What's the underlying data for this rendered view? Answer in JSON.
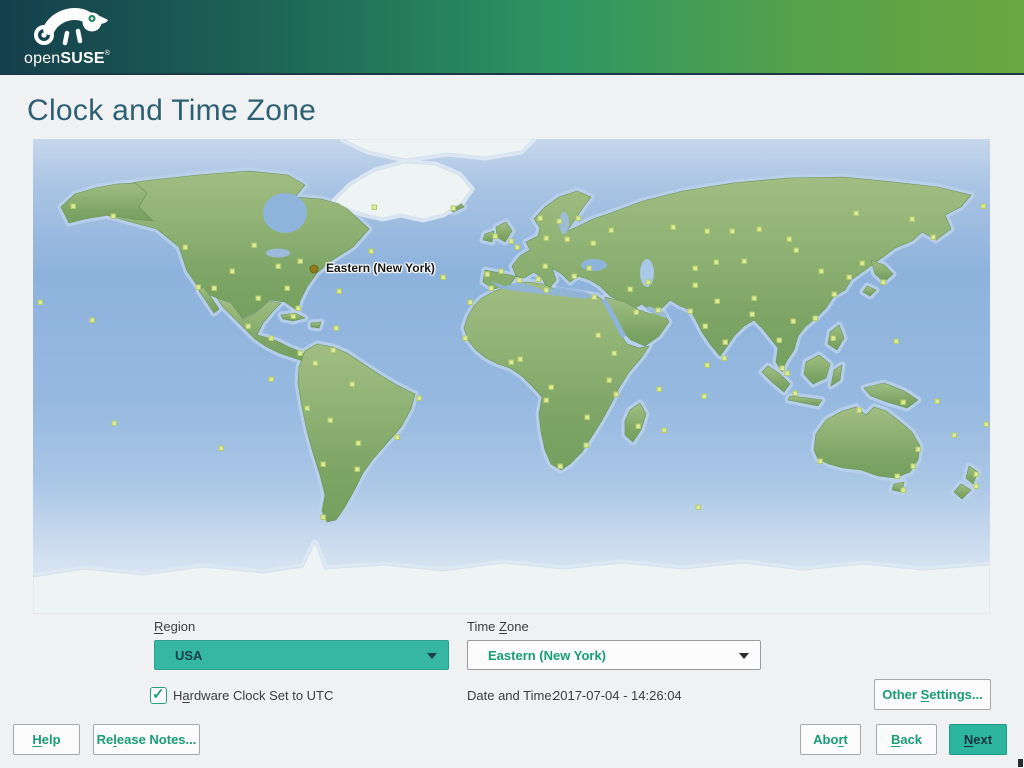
{
  "header": {
    "logo_open": "open",
    "logo_suse": "SUSE",
    "logo_reg": "®"
  },
  "page": {
    "title": "Clock and Time Zone"
  },
  "map": {
    "marker_label": "Eastern (New York)"
  },
  "form": {
    "region": {
      "label_accel": "R",
      "label_rest": "egion",
      "value": "USA"
    },
    "time_zone": {
      "label_pre": "Time ",
      "label_accel": "Z",
      "label_rest": "one",
      "value": "Eastern (New York)"
    },
    "hardware_clock": {
      "label_pre": "H",
      "label_accel": "a",
      "label_rest": "rdware Clock Set to UTC",
      "checked": true
    },
    "datetime": {
      "label": "Date and Time:",
      "value": "2017-07-04 - 14:26:04"
    },
    "other_settings": {
      "label_pre": "Other ",
      "label_accel": "S",
      "label_rest": "ettings..."
    }
  },
  "footer": {
    "help": {
      "label_accel": "H",
      "label_rest": "elp"
    },
    "release_notes": {
      "label_pre": "Re",
      "label_accel": "l",
      "label_rest": "ease Notes..."
    },
    "abort": {
      "label_pre": "Abo",
      "label_accel": "r",
      "label_rest": "t"
    },
    "back": {
      "label_accel": "B",
      "label_rest": "ack"
    },
    "next": {
      "label_accel": "N",
      "label_rest": "ext"
    }
  },
  "colors": {
    "accent_teal": "#2fb49e",
    "header_dark": "#153f4d",
    "header_green": "#6aa73f",
    "title_text": "#2d6073",
    "button_text": "#1a9c74",
    "marker_dot": "#8f7c1d"
  }
}
